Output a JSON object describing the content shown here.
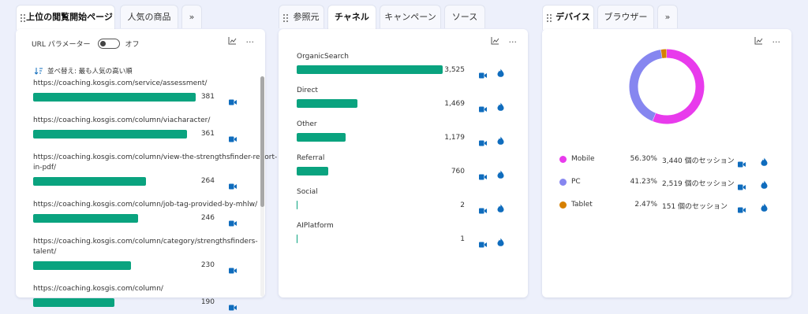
{
  "colors": {
    "bar": "#0aa37f",
    "accent": "#0f6cbd",
    "mobile": "#e83bec",
    "pc": "#8686f0",
    "tablet": "#d68000"
  },
  "panel1": {
    "tabs": [
      "上位の閲覧開始ページ",
      "人気の商品"
    ],
    "more_icon": "chevron-double-right-icon",
    "toggle_label": "URL パラメーター",
    "toggle_state": "オフ",
    "sort_label": "並べ替え: 最も人気の高い順",
    "rows": [
      {
        "url": "https://coaching.kosgis.com/service/assessment/",
        "value": "381",
        "count": 381
      },
      {
        "url": "https://coaching.kosgis.com/column/viacharacter/",
        "value": "361",
        "count": 361
      },
      {
        "url": "https://coaching.kosgis.com/column/view-the-strengthsfinder-report-",
        "url2": "in-pdf/",
        "value": "264",
        "count": 264
      },
      {
        "url": "https://coaching.kosgis.com/column/job-tag-provided-by-mhlw/",
        "value": "246",
        "count": 246
      },
      {
        "url": "https://coaching.kosgis.com/column/category/strengthsfinders-",
        "url2": "talent/",
        "value": "230",
        "count": 230
      },
      {
        "url": "https://coaching.kosgis.com/column/",
        "value": "190",
        "count": 190
      }
    ]
  },
  "panel2": {
    "tabs": [
      "参照元",
      "チャネル",
      "キャンペーン",
      "ソース"
    ],
    "rows": [
      {
        "label": "OrganicSearch",
        "value": "3,525",
        "count": 3525
      },
      {
        "label": "Direct",
        "value": "1,469",
        "count": 1469
      },
      {
        "label": "Other",
        "value": "1,179",
        "count": 1179
      },
      {
        "label": "Referral",
        "value": "760",
        "count": 760
      },
      {
        "label": "Social",
        "value": "2",
        "count": 2
      },
      {
        "label": "AIPlatform",
        "value": "1",
        "count": 1
      }
    ]
  },
  "panel3": {
    "tabs": [
      "デバイス",
      "ブラウザー"
    ],
    "rows": [
      {
        "label": "Mobile",
        "pct": "56.30%",
        "sessions": "3,440 個のセッション",
        "share": 56.3
      },
      {
        "label": "PC",
        "pct": "41.23%",
        "sessions": "2,519 個のセッション",
        "share": 41.23
      },
      {
        "label": "Tablet",
        "pct": "2.47%",
        "sessions": "151 個のセッション",
        "share": 2.47
      }
    ]
  }
}
